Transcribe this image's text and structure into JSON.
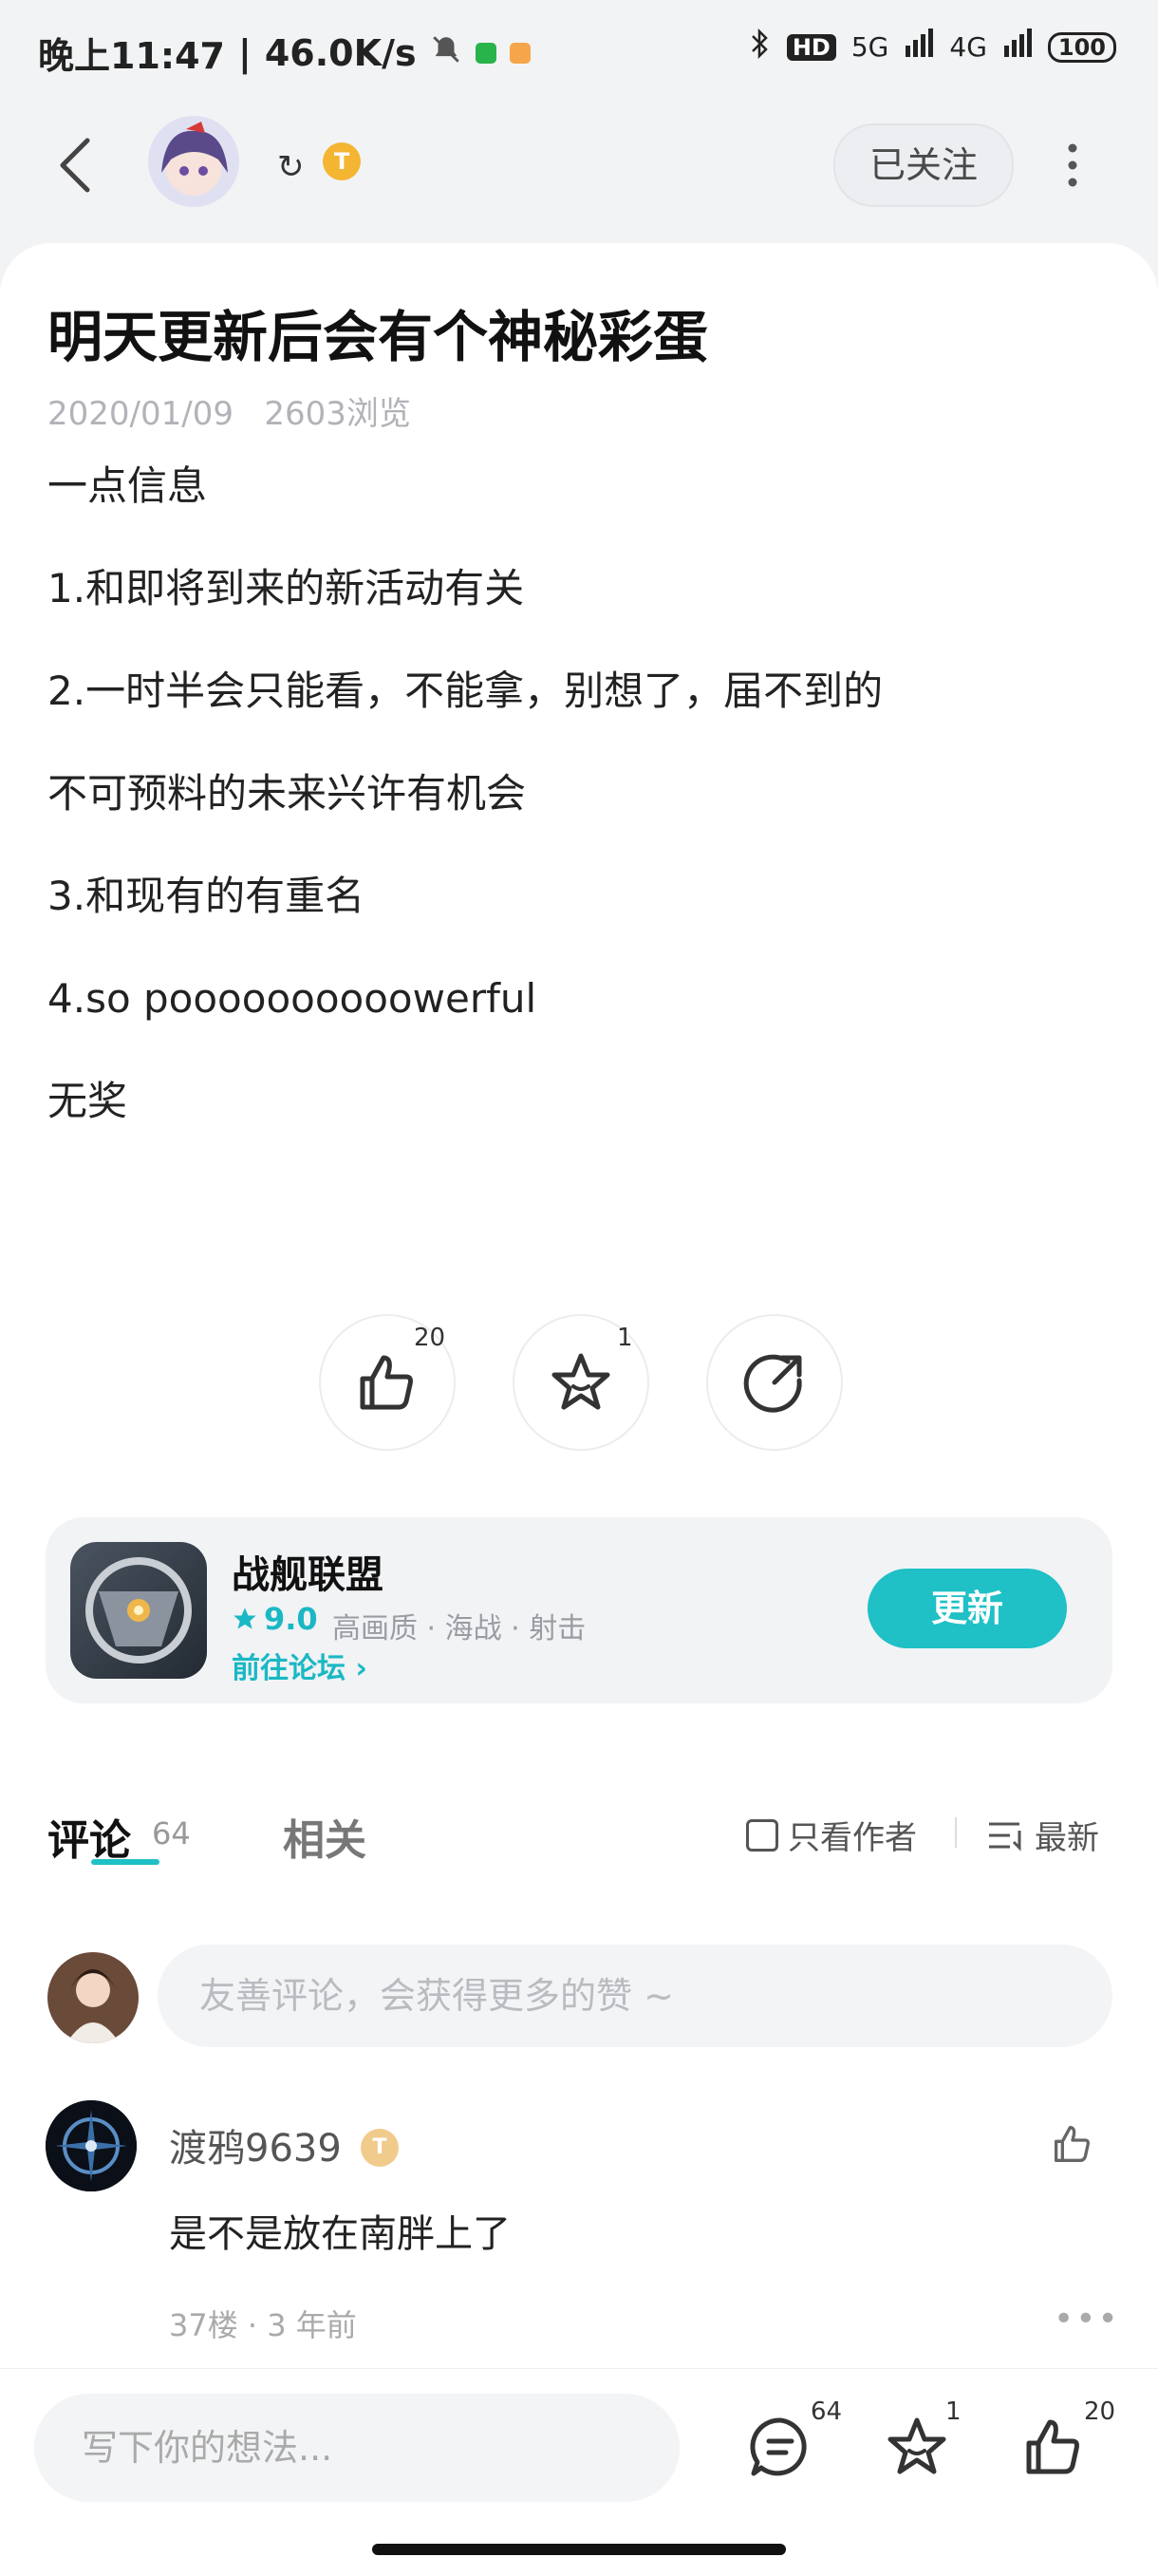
{
  "status_bar": {
    "time": "晚上11:47",
    "speed": "46.0K/s",
    "hd": "HD",
    "net1": "5G",
    "net2": "4G",
    "battery": "100"
  },
  "header": {
    "refresh_glyph": "↻",
    "level_badge": "T",
    "follow_label": "已关注"
  },
  "post": {
    "title": "明天更新后会有个神秘彩蛋",
    "date": "2020/01/09",
    "views": "2603浏览",
    "lines": [
      "一点信息",
      "1.和即将到来的新活动有关",
      "2.一时半会只能看，不能拿，别想了，届不到的",
      "不可预料的未来兴许有机会",
      "3.和现有的有重名",
      "4.so poooooooooowerful",
      "无奖"
    ]
  },
  "actions": {
    "like_count": "20",
    "fav_count": "1"
  },
  "game": {
    "name": "战舰联盟",
    "rating": "9.0",
    "tags": "高画质 · 海战 · 射击",
    "forum_link": "前往论坛",
    "update_label": "更新"
  },
  "comments": {
    "tab_comments": "评论",
    "tab_comments_count": "64",
    "tab_related": "相关",
    "only_author": "只看作者",
    "sort_label": "最新",
    "input_placeholder": "友善评论，会获得更多的赞 ~",
    "items": [
      {
        "user": "渡鸦9639",
        "badge": "T",
        "text": "是不是放在南胖上了",
        "meta": "37楼 · 3 年前"
      }
    ]
  },
  "bottom_bar": {
    "placeholder": "写下你的想法...",
    "comment_count": "64",
    "fav_count": "1",
    "like_count": "20"
  },
  "colors": {
    "accent": "#1fc0c6",
    "gold": "#f4b533"
  }
}
